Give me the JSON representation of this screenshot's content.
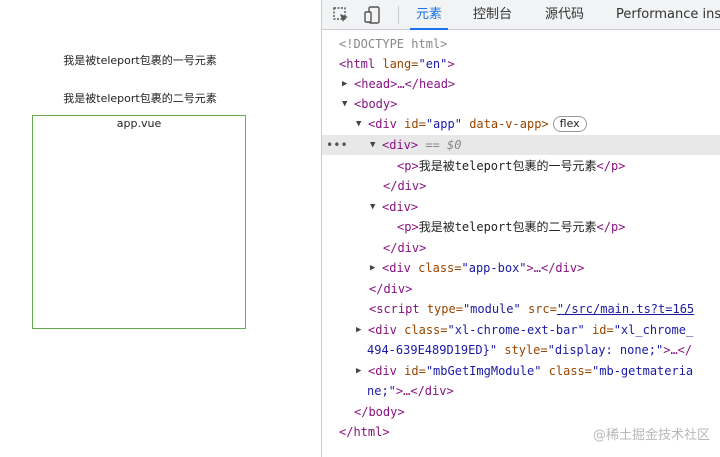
{
  "preview": {
    "teleport_p1": "我是被teleport包裹的一号元素",
    "teleport_p2": "我是被teleport包裹的二号元素",
    "app_box_label": "app.vue"
  },
  "devtools": {
    "tabs": {
      "elements": "元素",
      "console": "控制台",
      "sources": "源代码",
      "performance": "Performance insi"
    },
    "selected_marker": "== $0",
    "flex_badge": "flex",
    "ellipsis": "…",
    "dom": {
      "doctype": "<!DOCTYPE html>",
      "html_open_tag": "<html",
      "html_lang_attr": "lang=",
      "html_lang_val": "\"en\"",
      "head_collapsed": "<head>…</head>",
      "body_open": "<body>",
      "div_app_tag": "<div",
      "div_app_attr_id": "id=",
      "div_app_val_id": "\"app\"",
      "div_app_attr2": "data-v-app>",
      "div_selected": "<div>",
      "p_open": "<p>",
      "p1_text": "我是被teleport包裹的一号元素",
      "p_close": "</p>",
      "div_close": "</div>",
      "div2_open": "<div>",
      "p2_text": "我是被teleport包裹的二号元素",
      "appbox_tag": "<div",
      "appbox_attr": "class=",
      "appbox_val": "\"app-box\"",
      "appbox_rest": ">…</div>",
      "script_tag": "<script",
      "script_type_attr": "type=",
      "script_type_val": "\"module\"",
      "script_src_attr": "src=",
      "script_src_val": "\"/src/main.ts?t=165",
      "xl_tag": "<div",
      "xl_class_attr": "class=",
      "xl_class_val": "\"xl-chrome-ext-bar\"",
      "xl_id_attr": "id=",
      "xl_id_val": "\"xl_chrome_",
      "xl_line2_val": "494-639E489D19ED}\"",
      "xl_style_attr": "style=",
      "xl_style_val": "\"display: none;\"",
      "xl_rest": ">…</",
      "mb_tag": "<div",
      "mb_id_attr": "id=",
      "mb_id_val": "\"mbGetImgModule\"",
      "mb_class_attr": "class=",
      "mb_class_val": "\"mb-getmateria",
      "mb_line2_val": "ne;\"",
      "mb_rest": ">…</div>",
      "body_close": "</body>",
      "html_close": "</html>"
    }
  },
  "watermark": "@稀土掘金技术社区"
}
